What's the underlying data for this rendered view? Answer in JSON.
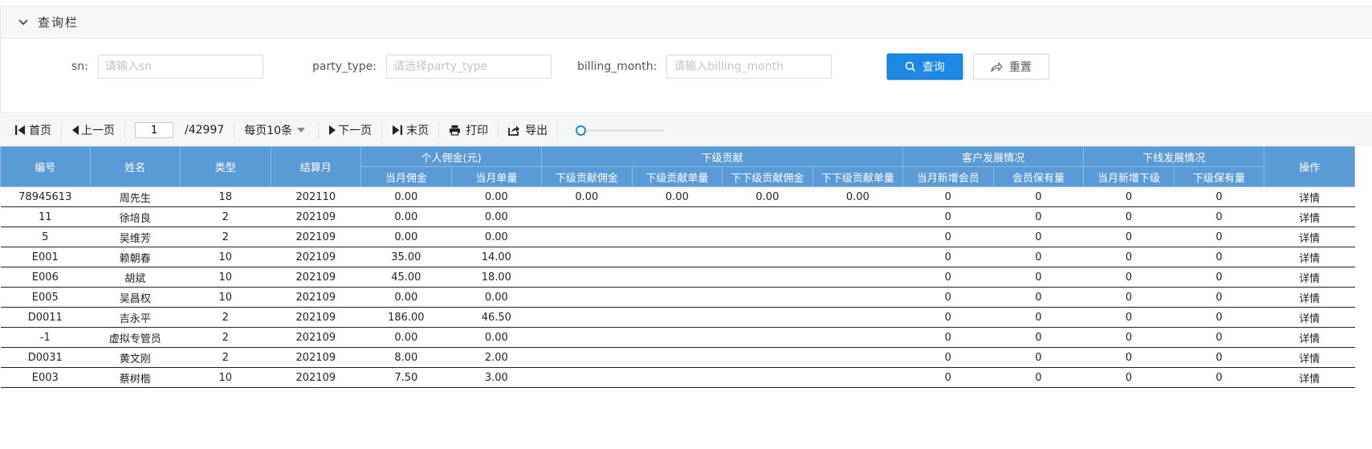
{
  "query": {
    "title": "查询栏",
    "fields": [
      {
        "label": "sn:",
        "value": "",
        "placeholder": "请输入sn"
      },
      {
        "label": "party_type:",
        "value": "",
        "placeholder": "请选择party_type"
      },
      {
        "label": "billing_month:",
        "value": "",
        "placeholder": "请输入billing_month"
      }
    ],
    "search_label": "查询",
    "reset_label": "重置"
  },
  "pager": {
    "first": "首页",
    "prev": "上一页",
    "current_page": "1",
    "total_pages": "/42997",
    "page_size": "每页10条",
    "next": "下一页",
    "last": "末页",
    "print": "打印",
    "export": "导出",
    "zoom_level": 0
  },
  "table": {
    "headers": {
      "id": "编号",
      "name": "姓名",
      "type": "类型",
      "month": "结算月",
      "personal": "个人佣金(元)",
      "personal_commission": "当月佣金",
      "personal_orders": "当月单量",
      "sub": "下级贡献",
      "sub_commission": "下级贡献佣金",
      "sub_orders": "下级贡献单量",
      "subsub_commission": "下下级贡献佣金",
      "subsub_orders": "下下级贡献单量",
      "customer": "客户发展情况",
      "new_members": "当月新增会员",
      "member_retention": "会员保有量",
      "downline": "下线发展情况",
      "new_subordinates": "当月新增下级",
      "subordinate_retention": "下级保有量",
      "action": "操作"
    },
    "rows": [
      [
        "78945613",
        "周先生",
        "18",
        "202110",
        "0.00",
        "0.00",
        "0.00",
        "0.00",
        "0.00",
        "0.00",
        "0",
        "0",
        "0",
        "0",
        "详情"
      ],
      [
        "11",
        "徐培良",
        "2",
        "202109",
        "0.00",
        "0.00",
        "",
        "",
        "",
        "",
        "0",
        "0",
        "0",
        "0",
        "详情"
      ],
      [
        "5",
        "吴维芳",
        "2",
        "202109",
        "0.00",
        "0.00",
        "",
        "",
        "",
        "",
        "0",
        "0",
        "0",
        "0",
        "详情"
      ],
      [
        "E001",
        "赖朝春",
        "10",
        "202109",
        "35.00",
        "14.00",
        "",
        "",
        "",
        "",
        "0",
        "0",
        "0",
        "0",
        "详情"
      ],
      [
        "E006",
        "胡斌",
        "10",
        "202109",
        "45.00",
        "18.00",
        "",
        "",
        "",
        "",
        "0",
        "0",
        "0",
        "0",
        "详情"
      ],
      [
        "E005",
        "吴昌权",
        "10",
        "202109",
        "0.00",
        "0.00",
        "",
        "",
        "",
        "",
        "0",
        "0",
        "0",
        "0",
        "详情"
      ],
      [
        "D0011",
        "吉永平",
        "2",
        "202109",
        "186.00",
        "46.50",
        "",
        "",
        "",
        "",
        "0",
        "0",
        "0",
        "0",
        "详情"
      ],
      [
        "-1",
        "虚拟专管员",
        "2",
        "202109",
        "0.00",
        "0.00",
        "",
        "",
        "",
        "",
        "0",
        "0",
        "0",
        "0",
        "详情"
      ],
      [
        "D0031",
        "黄文刚",
        "2",
        "202109",
        "8.00",
        "2.00",
        "",
        "",
        "",
        "",
        "0",
        "0",
        "0",
        "0",
        "详情"
      ],
      [
        "E003",
        "蔡树楷",
        "10",
        "202109",
        "7.50",
        "3.00",
        "",
        "",
        "",
        "",
        "0",
        "0",
        "0",
        "0",
        "详情"
      ]
    ]
  },
  "colors": {
    "accent": "#1e88e5",
    "header_bg": "#5b9bd5"
  },
  "icons": [
    "chevron-down-icon",
    "search-icon",
    "share-icon",
    "first-page-icon",
    "prev-page-icon",
    "next-page-icon",
    "last-page-icon",
    "print-icon",
    "export-icon"
  ]
}
